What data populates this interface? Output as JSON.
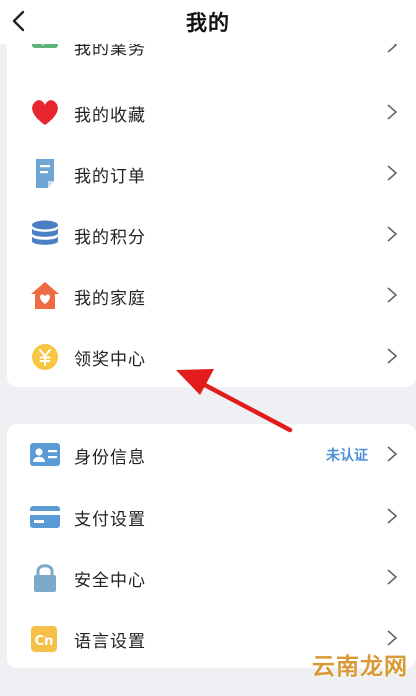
{
  "header": {
    "title": "我的",
    "back_icon": "chevron-left-icon"
  },
  "group1": {
    "items": [
      {
        "label": "我的業务",
        "icon": "business-icon"
      },
      {
        "label": "我的收藏",
        "icon": "heart-icon"
      },
      {
        "label": "我的订单",
        "icon": "order-document-icon"
      },
      {
        "label": "我的积分",
        "icon": "points-database-icon"
      },
      {
        "label": "我的家庭",
        "icon": "family-house-icon"
      },
      {
        "label": "领奖中心",
        "icon": "yuan-coin-icon"
      }
    ]
  },
  "group2": {
    "items": [
      {
        "label": "身份信息",
        "icon": "id-card-icon",
        "status": "未认证"
      },
      {
        "label": "支付设置",
        "icon": "bank-card-icon"
      },
      {
        "label": "安全中心",
        "icon": "lock-icon"
      },
      {
        "label": "语言设置",
        "icon": "language-cn-icon"
      }
    ]
  },
  "watermark": "云南龙网",
  "colors": {
    "heart": "#e8262f",
    "order": "#6fa5d3",
    "points": "#4a7fc1",
    "house": "#ee6a43",
    "coin": "#f7c744",
    "idcard": "#5b9bd5",
    "lock": "#7aa9c9",
    "lang": "#f7c04a",
    "status": "#4d8fd4",
    "annotation_arrow": "#e21b1b"
  }
}
